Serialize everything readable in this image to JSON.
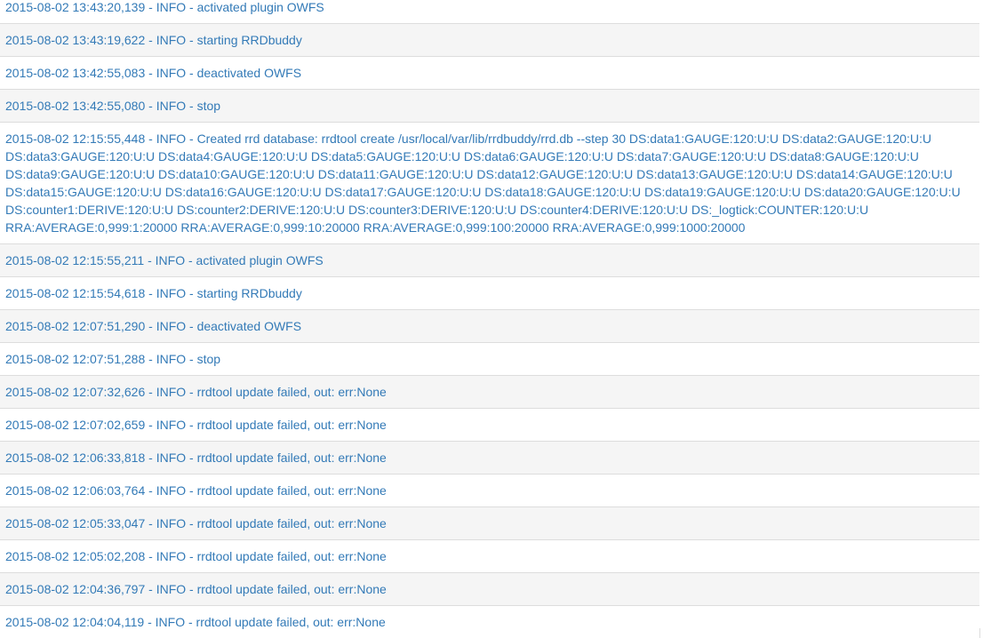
{
  "log_entries": [
    "2015-08-02 13:43:20,139 - INFO - activated plugin OWFS",
    "2015-08-02 13:43:19,622 - INFO - starting RRDbuddy",
    "2015-08-02 13:42:55,083 - INFO - deactivated OWFS",
    "2015-08-02 13:42:55,080 - INFO - stop",
    "2015-08-02 12:15:55,448 - INFO - Created rrd database: rrdtool create /usr/local/var/lib/rrdbuddy/rrd.db --step 30 DS:data1:GAUGE:120:U:U DS:data2:GAUGE:120:U:U DS:data3:GAUGE:120:U:U DS:data4:GAUGE:120:U:U DS:data5:GAUGE:120:U:U DS:data6:GAUGE:120:U:U DS:data7:GAUGE:120:U:U DS:data8:GAUGE:120:U:U DS:data9:GAUGE:120:U:U DS:data10:GAUGE:120:U:U DS:data11:GAUGE:120:U:U DS:data12:GAUGE:120:U:U DS:data13:GAUGE:120:U:U DS:data14:GAUGE:120:U:U DS:data15:GAUGE:120:U:U DS:data16:GAUGE:120:U:U DS:data17:GAUGE:120:U:U DS:data18:GAUGE:120:U:U DS:data19:GAUGE:120:U:U DS:data20:GAUGE:120:U:U DS:counter1:DERIVE:120:U:U DS:counter2:DERIVE:120:U:U DS:counter3:DERIVE:120:U:U DS:counter4:DERIVE:120:U:U DS:_logtick:COUNTER:120:U:U RRA:AVERAGE:0,999:1:20000 RRA:AVERAGE:0,999:10:20000 RRA:AVERAGE:0,999:100:20000 RRA:AVERAGE:0,999:1000:20000",
    "2015-08-02 12:15:55,211 - INFO - activated plugin OWFS",
    "2015-08-02 12:15:54,618 - INFO - starting RRDbuddy",
    "2015-08-02 12:07:51,290 - INFO - deactivated OWFS",
    "2015-08-02 12:07:51,288 - INFO - stop",
    "2015-08-02 12:07:32,626 - INFO - rrdtool update failed, out: err:None",
    "2015-08-02 12:07:02,659 - INFO - rrdtool update failed, out: err:None",
    "2015-08-02 12:06:33,818 - INFO - rrdtool update failed, out: err:None",
    "2015-08-02 12:06:03,764 - INFO - rrdtool update failed, out: err:None",
    "2015-08-02 12:05:33,047 - INFO - rrdtool update failed, out: err:None",
    "2015-08-02 12:05:02,208 - INFO - rrdtool update failed, out: err:None",
    "2015-08-02 12:04:36,797 - INFO - rrdtool update failed, out: err:None",
    "2015-08-02 12:04:04,119 - INFO - rrdtool update failed, out: err:None"
  ],
  "colors": {
    "text": "#337ab7",
    "row_alt": "#f5f5f5",
    "border": "#dddddd"
  }
}
